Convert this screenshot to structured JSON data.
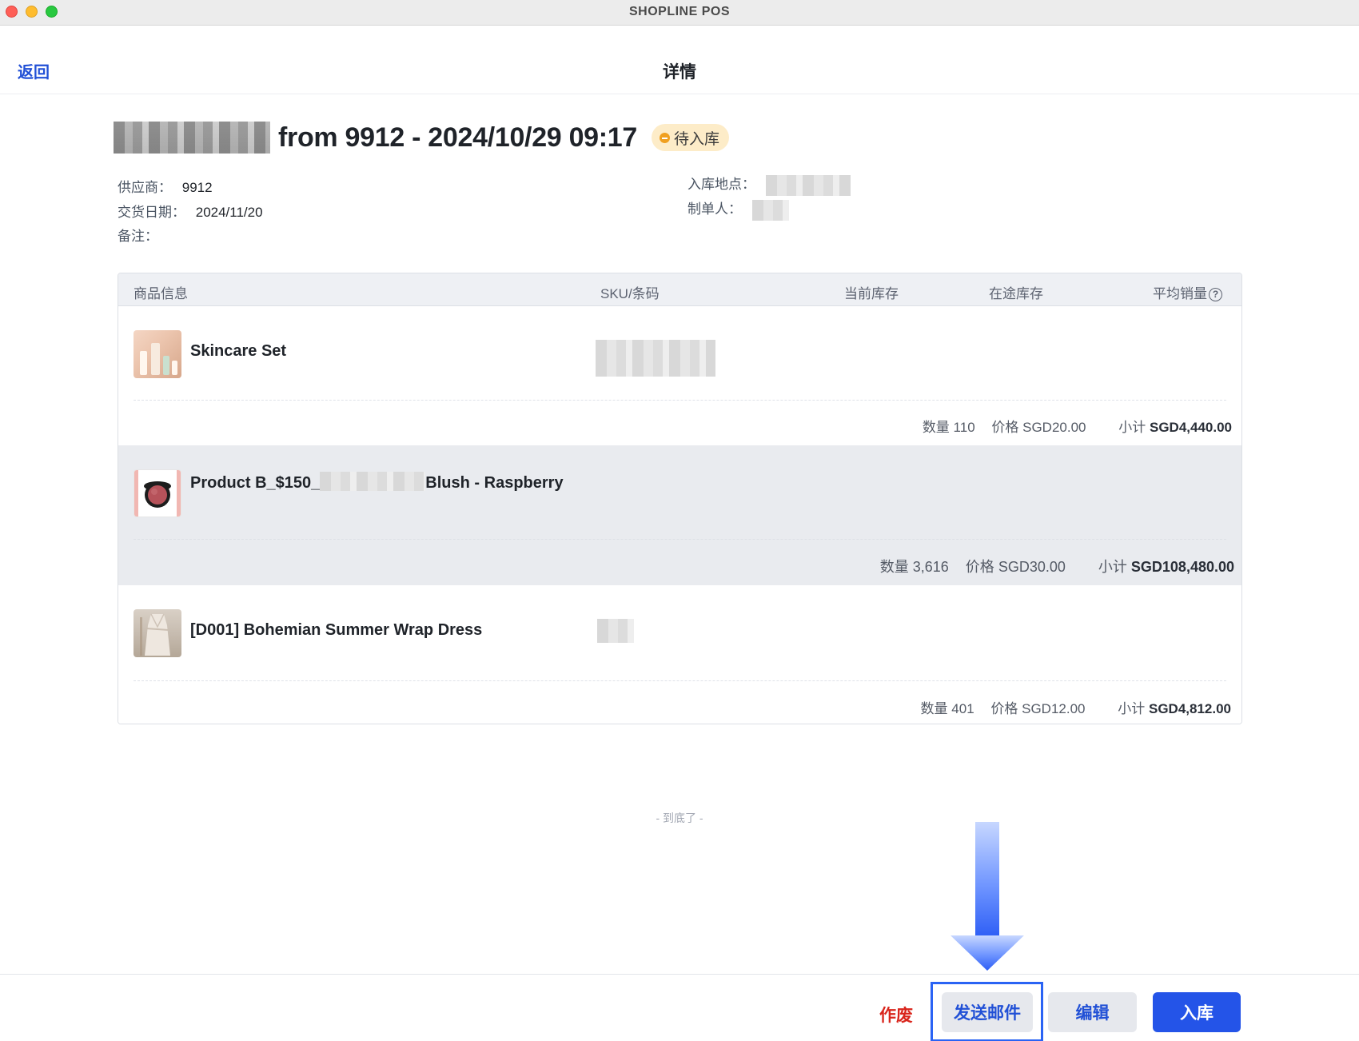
{
  "window": {
    "title": "SHOPLINE POS"
  },
  "header": {
    "back_label": "返回",
    "title": "详情"
  },
  "order": {
    "title": "from 9912 - 2024/10/29 09:17",
    "status": "待入库"
  },
  "info": {
    "supplier_label": "供应商：",
    "supplier_value": "9912",
    "delivery_label": "交货日期：",
    "delivery_value": "2024/11/20",
    "remark_label": "备注：",
    "location_label": "入库地点：",
    "creator_label": "制单人："
  },
  "table": {
    "columns": [
      "商品信息",
      "SKU/条码",
      "当前库存",
      "在途库存",
      "平均销量"
    ],
    "rows": [
      {
        "name": "Skincare Set",
        "qty_label": "数量",
        "qty": "110",
        "price_label": "价格",
        "price": "SGD20.00",
        "subtotal_label": "小计",
        "subtotal": "SGD4,440.00"
      },
      {
        "name_prefix": "Product B_$150_",
        "name_suffix": "Blush - Raspberry",
        "qty_label": "数量",
        "qty": "3,616",
        "price_label": "价格",
        "price": "SGD30.00",
        "subtotal_label": "小计",
        "subtotal": "SGD108,480.00"
      },
      {
        "name": "[D001] Bohemian Summer Wrap Dress",
        "qty_label": "数量",
        "qty": "401",
        "price_label": "价格",
        "price": "SGD12.00",
        "subtotal_label": "小计",
        "subtotal": "SGD4,812.00"
      }
    ],
    "end_text": "- 到底了 -"
  },
  "footer": {
    "void_label": "作废",
    "email_label": "发送邮件",
    "edit_label": "编辑",
    "stock_in_label": "入库"
  },
  "colors": {
    "primary": "#2454e8",
    "link": "#2150d6",
    "danger": "#d9251c",
    "status_bg": "#fdecc8",
    "status_dot": "#f0a020"
  }
}
